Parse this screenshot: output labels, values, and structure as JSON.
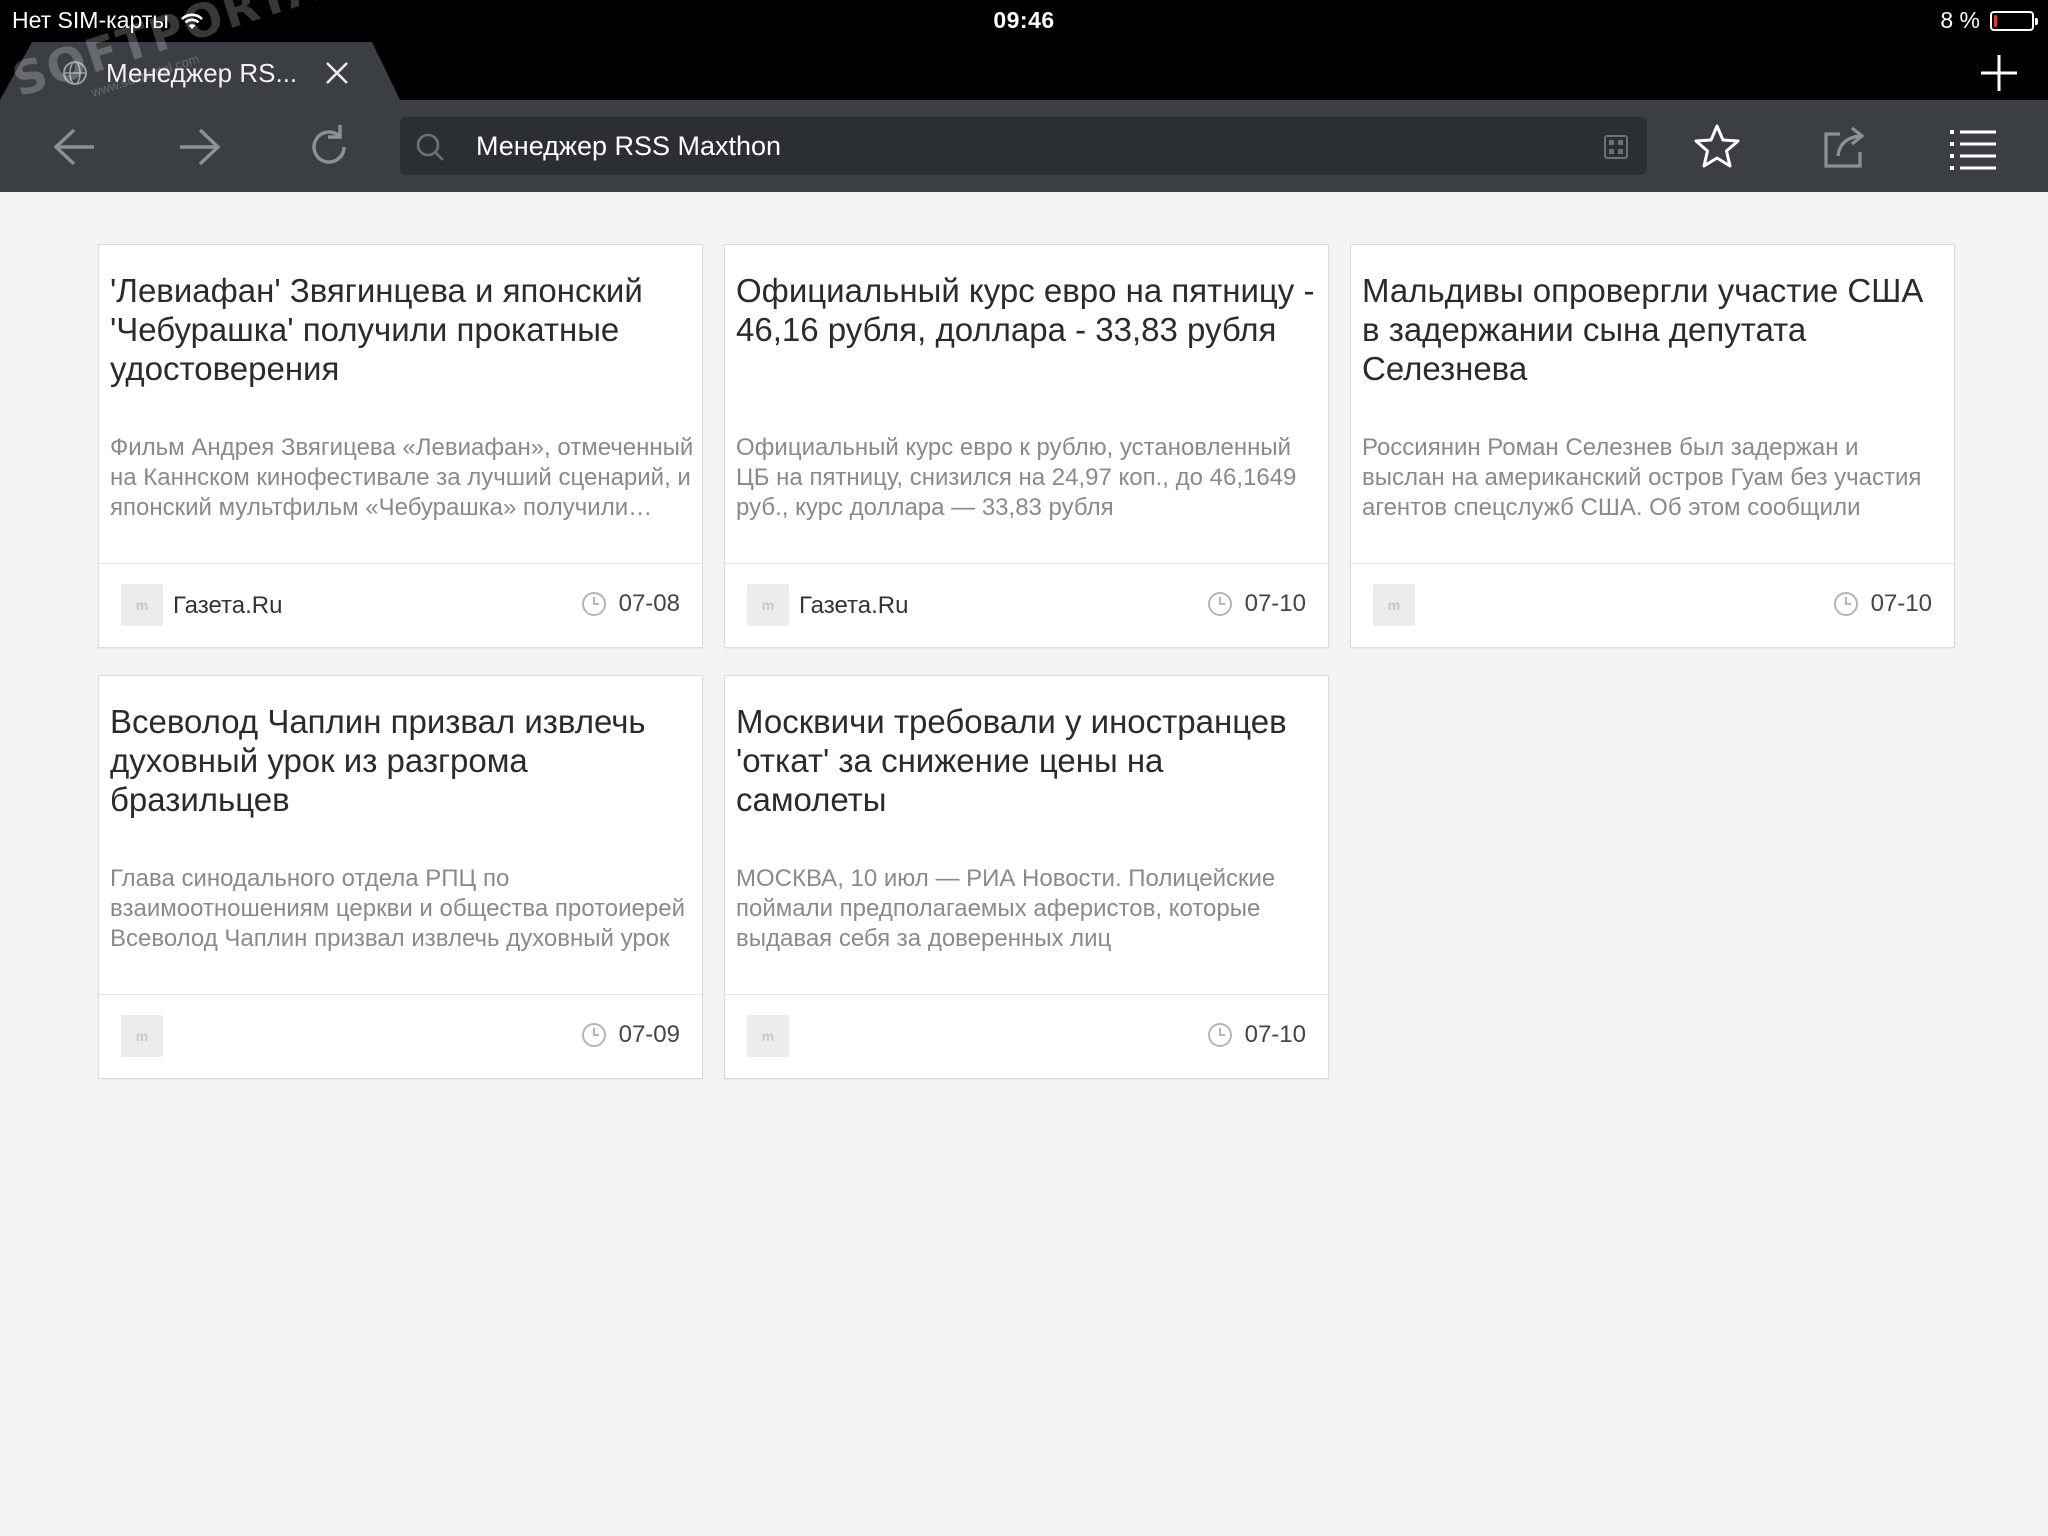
{
  "status": {
    "carrier": "Нет SIM-карты",
    "time": "09:46",
    "battery": "8 %",
    "battery_level": 0.08,
    "battery_color": "#e23a2e"
  },
  "tab": {
    "title": "Менеджер RS...",
    "globe_icon": "globe-icon",
    "close_icon": "close-icon"
  },
  "watermark": {
    "main": "SOFTPORTAL",
    "sub": "www.softportal.com"
  },
  "toolbar": {
    "back_icon": "arrow-left-icon",
    "forward_icon": "arrow-right-icon",
    "reload_icon": "reload-icon",
    "address": "Менеджер RSS Maxthon",
    "bookmark_icon": "star-icon",
    "share_icon": "share-icon",
    "menu_icon": "menu-icon",
    "new_tab_icon": "plus-icon"
  },
  "colors": {
    "toolbar_bg": "#3b3f44",
    "address_bg": "#2b2e32",
    "page_bg": "#f4f4f4"
  },
  "cards": [
    {
      "title": "'Левиафан' Звягинцева и японский 'Чебурашка' получили прокатные удостоверения",
      "summary": "Фильм Андрея Звягицева «Левиафан», отмеченный на Каннском кинофестивале за лучший сценарий, и японский мультфильм «Чебурашка» получили прокатные удостоверения",
      "source": "Газета.Ru",
      "source_icon": "m",
      "date": "07-08"
    },
    {
      "title": "Официальный курс евро на пятницу - 46,16 рубля, доллара - 33,83 рубля",
      "summary": "Официальный курс евро к рублю, установленный ЦБ на пятницу, снизился на 24,97 коп., до 46,1649 руб., курс доллара — 33,83 рубля",
      "source": "Газета.Ru",
      "source_icon": "m",
      "date": "07-10"
    },
    {
      "title": "Мальдивы опровергли участие США в задержании сына депутата Селезнева",
      "summary": "Россиянин Роман Селезнев был задержан и выслан на американский остров Гуам без участия агентов спецслужб США. Об этом сообщили",
      "source": "",
      "source_icon": "m",
      "date": "07-10"
    },
    {
      "title": "Всеволод Чаплин призвал извлечь духовный урок из разгрома бразильцев",
      "summary": "Глава синодального отдела РПЦ по взаимоотношениям церкви и общества протоиерей Всеволод Чаплин призвал извлечь духовный урок",
      "source": "",
      "source_icon": "m",
      "date": "07-09"
    },
    {
      "title": "Москвичи требовали у иностранцев 'откат' за снижение цены на самолеты",
      "summary": "МОСКВА, 10 июл — РИА Новости. Полицейские поймали предполагаемых аферистов, которые выдавая себя за доверенных лиц",
      "source": "",
      "source_icon": "m",
      "date": "07-10"
    }
  ]
}
